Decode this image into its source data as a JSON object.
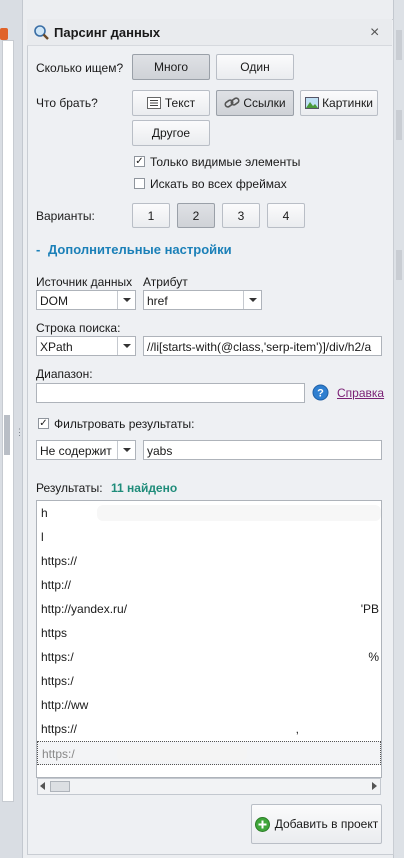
{
  "panel": {
    "title": "Парсинг данных",
    "close_label": "×"
  },
  "how_many": {
    "label": "Сколько ищем?",
    "options": [
      "Много",
      "Один"
    ],
    "selected": "Много"
  },
  "what": {
    "label": "Что брать?",
    "options": [
      "Текст",
      "Ссылки",
      "Картинки",
      "Другое"
    ],
    "selected": "Ссылки"
  },
  "checks": {
    "visible_only": {
      "label": "Только видимые элементы",
      "checked": true
    },
    "all_frames": {
      "label": "Искать во всех фреймах",
      "checked": false
    }
  },
  "variants": {
    "label": "Варианты:",
    "options": [
      "1",
      "2",
      "3",
      "4"
    ],
    "selected": "2"
  },
  "advanced": {
    "toggle": "-",
    "label": "Дополнительные настройки"
  },
  "source": {
    "label": "Источник данных",
    "value": "DOM"
  },
  "attribute": {
    "label": "Атрибут",
    "value": "href"
  },
  "search": {
    "label": "Строка поиска:",
    "mode": "XPath",
    "query": "//li[starts-with(@class,'serp-item')]/div/h2/a"
  },
  "range": {
    "label": "Диапазон:",
    "value": "",
    "help_label": "Справка"
  },
  "filter": {
    "label": "Фильтровать результаты:",
    "checked": true,
    "mode": "Не содержит",
    "value": "yabs"
  },
  "results": {
    "label": "Результаты:",
    "count_text": "11 найдено",
    "rows": [
      "h",
      "l",
      "https://",
      "http://",
      "http://yandex.ru/",
      "https",
      "https:/",
      "https:/",
      "http://ww",
      "https://",
      "https:/"
    ],
    "row_tails": [
      "",
      "",
      "",
      "",
      "'PB",
      "",
      "%",
      "",
      "",
      ",",
      ""
    ]
  },
  "add_button": {
    "label": "Добавить в проект"
  }
}
